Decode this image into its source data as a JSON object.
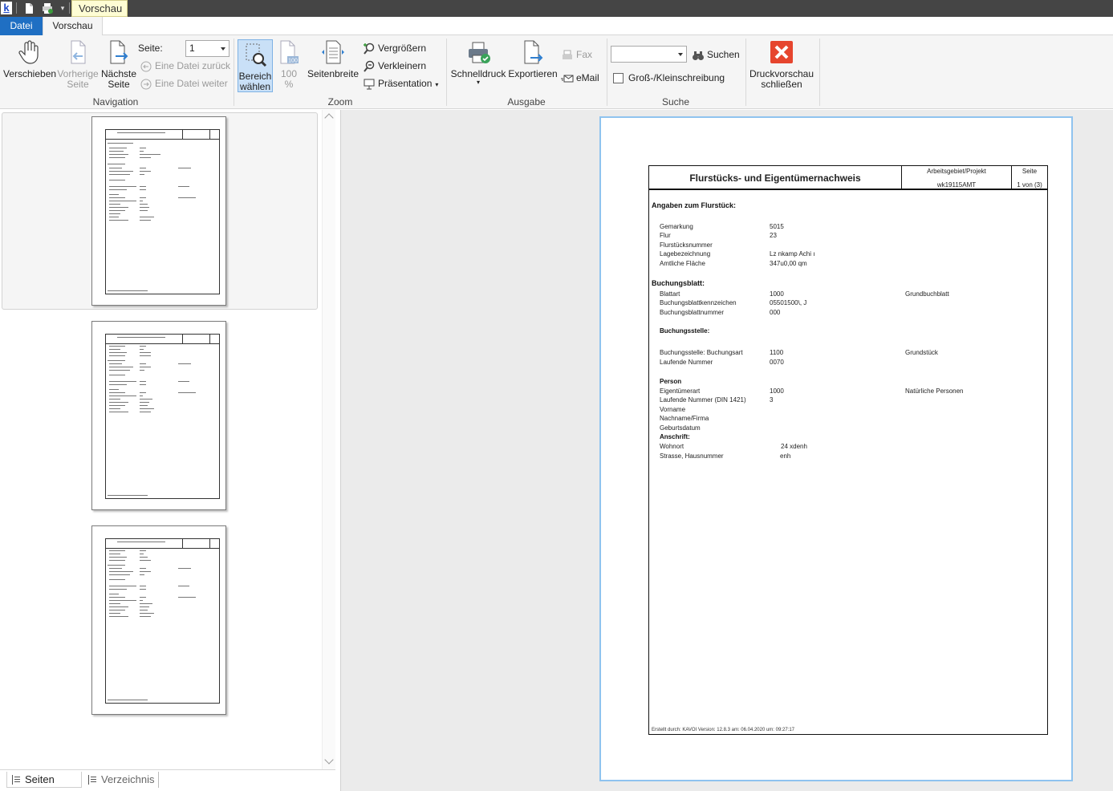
{
  "titlebar": {
    "app_icon_letter": "k",
    "title": "Vorschau"
  },
  "tabs": {
    "datei": "Datei",
    "vorschau": "Vorschau"
  },
  "ribbon": {
    "navigation": {
      "label": "Navigation",
      "verschieben": "Verschieben",
      "vorherige_l1": "Vorherige",
      "vorherige_l2": "Seite",
      "naechste_l1": "Nächste",
      "naechste_l2": "Seite",
      "seite_label": "Seite:",
      "seite_value": "1",
      "datei_zurueck": "Eine Datei zurück",
      "datei_weiter": "Eine Datei weiter"
    },
    "zoom": {
      "label": "Zoom",
      "bereich_l1": "Bereich",
      "bereich_l2": "wählen",
      "hundert_l1": "100",
      "hundert_l2": "%",
      "seitenbreite": "Seitenbreite",
      "vergroessern": "Vergrößern",
      "verkleinern": "Verkleinern",
      "praesentation": "Präsentation"
    },
    "ausgabe": {
      "label": "Ausgabe",
      "schnelldruck": "Schnelldruck",
      "exportieren": "Exportieren",
      "fax": "Fax",
      "email": "eMail"
    },
    "suche": {
      "label": "Suche",
      "search_value": "",
      "suchen": "Suchen",
      "gross_klein": "Groß-/Kleinschreibung"
    },
    "schliessen_l1": "Druckvorschau",
    "schliessen_l2": "schließen"
  },
  "bottom_tabs": {
    "seiten": "Seiten",
    "verzeichnis": "Verzeichnis"
  },
  "report": {
    "title": "Flurstücks- und Eigentümernachweis",
    "project_label": "Arbeitsgebiet/Projekt",
    "project_value": "wk19115AMT",
    "page_label": "Seite",
    "page_value": "1 von (3)",
    "flurstueck_heading": "Angaben zum Flurstück:",
    "gemarkung_l": "Gemarkung",
    "gemarkung_v": "5015",
    "flur_l": "Flur",
    "flur_v": "23",
    "flurstuecksnummer_l": "Flurstücksnummer",
    "lage_l": "Lagebezeichnung",
    "lage_v": "Lz      nkamp Achi    ı",
    "flaeche_l": "Amtliche Fläche",
    "flaeche_v": "347u0,00 qm",
    "buchungsblatt_heading": "Buchungsblatt:",
    "blattart_l": "Blattart",
    "blattart_v": "1000",
    "blattart_v2": "Grundbuchblatt",
    "bbk_l": "Buchungsblattkennzeichen",
    "bbk_v": "05501500\\,    J",
    "bbn_l": "Buchungsblattnummer",
    "bbn_v": "000",
    "buchungsstelle_heading": "Buchungsstelle:",
    "bsa_l": "Buchungsstelle: Buchungsart",
    "bsa_v": "1100",
    "bsa_v2": "Grundstück",
    "lfd_l": "Laufende Nummer",
    "lfd_v": "0070",
    "person_heading": "Person",
    "eart_l": "Eigentümerart",
    "eart_v": "1000",
    "eart_v2": "Natürliche Personen",
    "lfd_din_l": "Laufende Nummer (DIN 1421)",
    "lfd_din_v": "3",
    "vorname_l": "Vorname",
    "nachname_l": "Nachname/Firma",
    "geb_l": "Geburtsdatum",
    "anschrift_heading": "Anschrift:",
    "wohnort_l": "Wohnort",
    "wohnort_v": "24      xdenh",
    "strasse_l": "Strasse, Hausnummer",
    "strasse_v": "enh",
    "footer": "Erstellt durch: KAVOI Version: 12.8.3 am: 06.04.2020 um: 09:27:17"
  }
}
